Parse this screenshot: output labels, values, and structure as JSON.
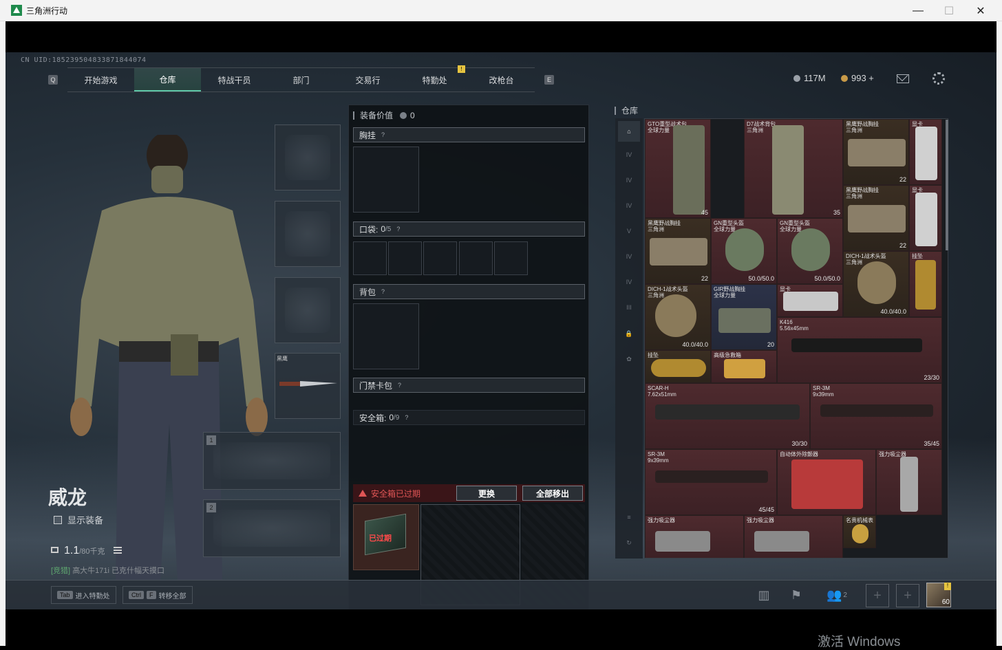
{
  "window": {
    "title": "三角洲行动",
    "minimize": "—",
    "maximize": "☐",
    "close": "✕"
  },
  "uid": "CN UID:185239504833871844074",
  "nav": {
    "left_key": "Q",
    "right_key": "E",
    "tabs": [
      "开始游戏",
      "仓库",
      "特战干员",
      "部门",
      "交易行",
      "特勤处",
      "改枪台"
    ],
    "active_tab": "仓库",
    "alert_badge": "!"
  },
  "currency": {
    "coin_a": "117M",
    "coin_b": "993 +"
  },
  "colors": {
    "accent": "#5fc8a8",
    "rare_red": "#4e2a2e",
    "alert": "#e05555"
  },
  "character": {
    "name": "威龙",
    "show_gear_label": "显示装备",
    "weight_value": "1.1",
    "weight_max": "/80千克",
    "status_prefix": "[竞猎]",
    "status_text": "高大牛171i 已克什幅天摸口"
  },
  "slots": {
    "melee_tag": "黑鹰",
    "primary_num": "1",
    "secondary_num": "2"
  },
  "equipment": {
    "value_label": "装备价值",
    "value": "0",
    "chest_label": "胸挂",
    "pocket_label": "口袋:",
    "pocket_count": "0",
    "pocket_max": "/5",
    "backpack_label": "背包",
    "keycard_label": "门禁卡包",
    "safe_label": "安全箱:",
    "safe_count": "0",
    "safe_max": "/9",
    "safe_expired": "安全箱已过期",
    "replace_btn": "更换",
    "move_all_btn": "全部移出",
    "case_expired": "已过期",
    "help": "?"
  },
  "warehouse": {
    "title": "仓库",
    "side_labels": [
      "IV",
      "IV",
      "IV",
      "V",
      "IV",
      "IV",
      "III"
    ],
    "items": [
      {
        "name": "GTO重型战术包",
        "sub": "全球力量",
        "count": "45"
      },
      {
        "name": "D7战术背包",
        "sub": "三角洲",
        "count": "35"
      },
      {
        "name": "黑鹰野战胸挂",
        "sub": "三角洲",
        "count": "22"
      },
      {
        "name": "显卡",
        "sub": "",
        "count": ""
      },
      {
        "name": "黑鹰野战胸挂",
        "sub": "三角洲",
        "count": "22"
      },
      {
        "name": "显卡",
        "sub": "",
        "count": ""
      },
      {
        "name": "黑鹰野战胸挂",
        "sub": "三角洲",
        "count": "22"
      },
      {
        "name": "GN重型头盔",
        "sub": "全球力量",
        "count": "50.0/50.0"
      },
      {
        "name": "GN重型头盔",
        "sub": "全球力量",
        "count": "50.0/50.0"
      },
      {
        "name": "DICH-1战术头盔",
        "sub": "三角洲",
        "count": "40.0/40.0"
      },
      {
        "name": "挂坠",
        "sub": "",
        "count": ""
      },
      {
        "name": "DICH-1战术头盔",
        "sub": "三角洲",
        "count": "40.0/40.0"
      },
      {
        "name": "GIR野战胸挂",
        "sub": "全球力量",
        "count": "20"
      },
      {
        "name": "显卡",
        "sub": "",
        "count": ""
      },
      {
        "name": "K416",
        "sub": "5.56x45mm",
        "count": "23/30"
      },
      {
        "name": "挂坠",
        "sub": "",
        "count": ""
      },
      {
        "name": "高级急救箱",
        "sub": "",
        "count": ""
      },
      {
        "name": "SCAR-H",
        "sub": "7.62x51mm",
        "count": "30/30"
      },
      {
        "name": "SR-3M",
        "sub": "9x39mm",
        "count": "35/45"
      },
      {
        "name": "SR-3M",
        "sub": "9x39mm",
        "count": "45/45"
      },
      {
        "name": "自动体外除颤器",
        "sub": "",
        "count": ""
      },
      {
        "name": "强力吸尘器",
        "sub": "",
        "count": ""
      },
      {
        "name": "强力吸尘器",
        "sub": "",
        "count": ""
      },
      {
        "name": "强力吸尘器",
        "sub": "",
        "count": ""
      },
      {
        "name": "名贵机械表",
        "sub": "",
        "count": ""
      }
    ]
  },
  "bottom": {
    "tab_key": "Tab",
    "tab_hint": "进入特勤处",
    "ctrl_key": "Ctrl",
    "f_key": "F",
    "ctrl_hint": "转移全部",
    "squad_count": "2",
    "avatar_level": "60",
    "avatar_alert": "!"
  },
  "watermark": "激活 Windows"
}
